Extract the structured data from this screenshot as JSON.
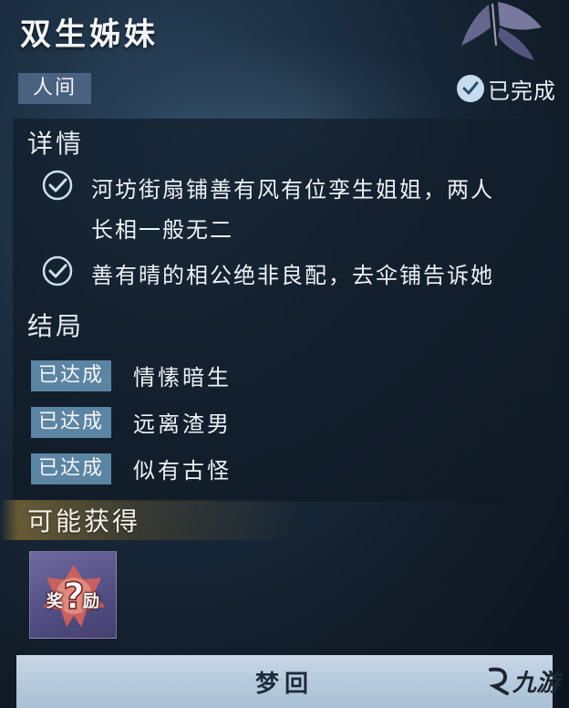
{
  "header": {
    "title": "双生姊妹",
    "region_tag": "人间",
    "status": "已完成"
  },
  "details": {
    "heading": "详情",
    "items": [
      {
        "text_line1": "河坊街扇铺善有风有位孪生姐姐，两人",
        "text_line2": "长相一般无二"
      },
      {
        "text_line1": "善有晴的相公绝非良配，去伞铺告诉她"
      }
    ]
  },
  "endings": {
    "heading": "结局",
    "items": [
      {
        "badge": "已达成",
        "text": "情愫暗生"
      },
      {
        "badge": "已达成",
        "text": "远离渣男"
      },
      {
        "badge": "已达成",
        "text": "似有古怪"
      }
    ]
  },
  "rewards": {
    "heading": "可能获得",
    "card_char1": "奖",
    "card_char2": "励"
  },
  "footer": {
    "button_label": "梦回"
  },
  "watermark": {
    "text": "九游"
  }
}
